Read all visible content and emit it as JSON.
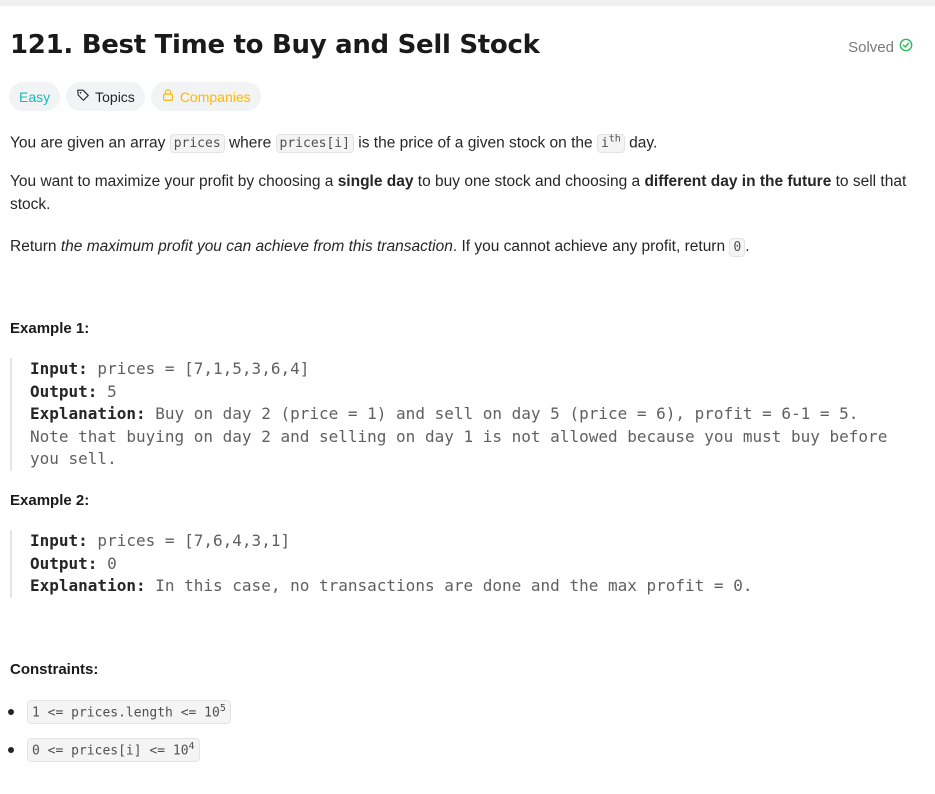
{
  "problem": {
    "title": "121. Best Time to Buy and Sell Stock",
    "status": "Solved"
  },
  "tags": {
    "difficulty": "Easy",
    "topics": "Topics",
    "companies": "Companies"
  },
  "description": {
    "p1_a": "You are given an array ",
    "p1_code1": "prices",
    "p1_b": " where ",
    "p1_code2": "prices[i]",
    "p1_c": " is the price of a given stock on the ",
    "p1_code3": "i",
    "p1_sup": "th",
    "p1_d": " day.",
    "p2_a": "You want to maximize your profit by choosing a ",
    "p2_bold1": "single day",
    "p2_b": " to buy one stock and choosing a ",
    "p2_bold2": "different day in the future",
    "p2_c": " to sell that stock.",
    "p3_a": "Return ",
    "p3_em": "the maximum profit you can achieve from this transaction",
    "p3_b": ". If you cannot achieve any profit, return ",
    "p3_code": "0",
    "p3_c": "."
  },
  "examples": [
    {
      "title": "Example 1:",
      "input_label": "Input:",
      "input": " prices = [7,1,5,3,6,4]",
      "output_label": "Output:",
      "output": " 5",
      "explanation_label": "Explanation:",
      "explanation": " Buy on day 2 (price = 1) and sell on day 5 (price = 6), profit = 6-1 = 5.\nNote that buying on day 2 and selling on day 1 is not allowed because you must buy before you sell."
    },
    {
      "title": "Example 2:",
      "input_label": "Input:",
      "input": " prices = [7,6,4,3,1]",
      "output_label": "Output:",
      "output": " 0",
      "explanation_label": "Explanation:",
      "explanation": " In this case, no transactions are done and the max profit = 0."
    }
  ],
  "constraints": {
    "title": "Constraints:",
    "items": [
      {
        "text": "1 <= prices.length <= 10",
        "sup": "5"
      },
      {
        "text": "0 <= prices[i] <= 10",
        "sup": "4"
      }
    ]
  },
  "colors": {
    "easy": "#1cb8b8",
    "companies": "#ffb800",
    "solved_check": "#2cbb5d"
  }
}
